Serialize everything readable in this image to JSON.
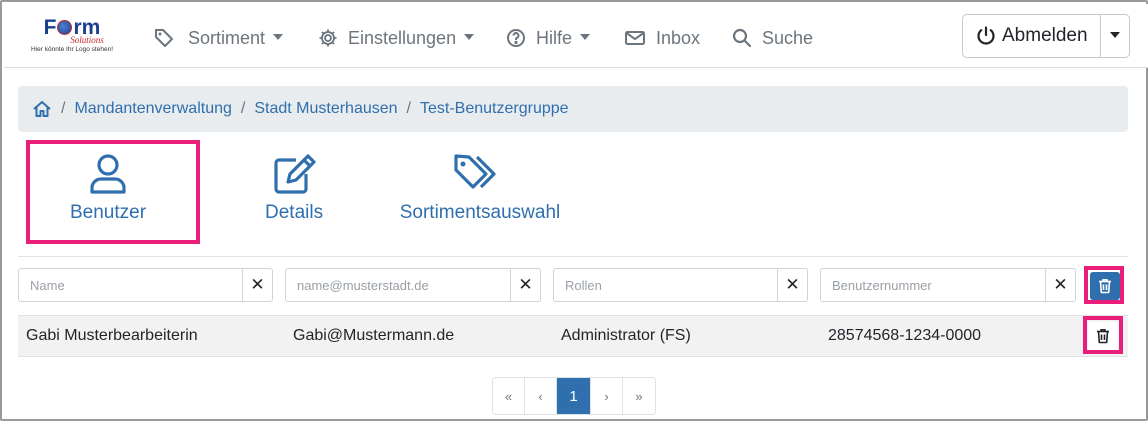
{
  "logo": {
    "word_left": "F",
    "word_right": "rm",
    "sub": "Solutions",
    "tagline": "Hier könnte Ihr Logo stehen!"
  },
  "nav": {
    "sortiment": "Sortiment",
    "einstellungen": "Einstellungen",
    "hilfe": "Hilfe",
    "inbox": "Inbox",
    "suche": "Suche",
    "logout": "Abmelden"
  },
  "breadcrumb": {
    "items": [
      "Mandantenverwaltung",
      "Stadt Musterhausen",
      "Test-Benutzergruppe"
    ],
    "separator": "/"
  },
  "tabs": {
    "benutzer": "Benutzer",
    "details": "Details",
    "sortimentsauswahl": "Sortimentsauswahl"
  },
  "filters": {
    "name_placeholder": "Name",
    "email_placeholder": "name@musterstadt.de",
    "rollen_placeholder": "Rollen",
    "nummer_placeholder": "Benutzernummer",
    "clear_symbol": "✕"
  },
  "table": {
    "rows": [
      {
        "name": "Gabi Musterbearbeiterin",
        "email": "Gabi@Mustermann.de",
        "rolle": "Administrator (FS)",
        "nummer": "28574568-1234-0000"
      }
    ]
  },
  "pagination": {
    "first": "«",
    "prev": "‹",
    "current": "1",
    "next": "›",
    "last": "»"
  },
  "colors": {
    "accent": "#2f6fae",
    "highlight": "#e91e7a",
    "nav_text": "#6c757d",
    "breadcrumb_bg": "#e9ecef",
    "row_bg": "#f2f2f2"
  },
  "icons": {
    "sortiment": "tags-icon",
    "einstellungen": "gear-icon",
    "hilfe": "question-circle-icon",
    "inbox": "envelope-icon",
    "suche": "search-icon",
    "logout": "power-icon",
    "home": "home-icon",
    "benutzer": "user-icon",
    "details": "edit-icon",
    "sortimentsauswahl": "tags-icon",
    "delete": "trash-icon"
  }
}
